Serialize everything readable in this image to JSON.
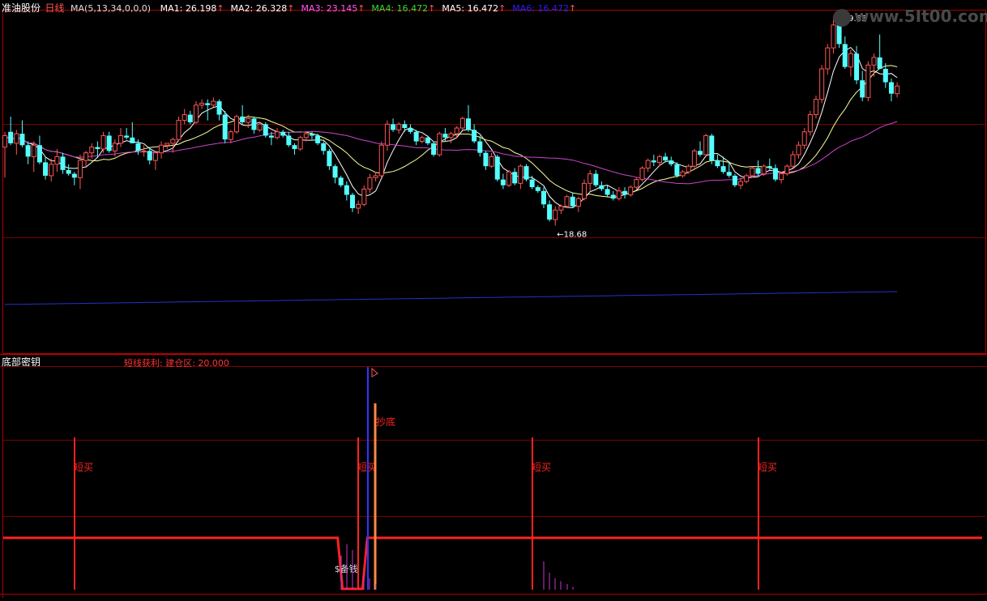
{
  "header": {
    "stock_name": "准油股份",
    "period": "日线",
    "ma_params": "MA(5,13,34,0,0,0)",
    "ma_items": [
      {
        "label": "MA1:",
        "value": "26.198",
        "arrow": "↑",
        "color": "#ffffff"
      },
      {
        "label": "MA2:",
        "value": "26.328",
        "arrow": "↑",
        "color": "#ffffff"
      },
      {
        "label": "MA3:",
        "value": "23.145",
        "arrow": "↑",
        "color": "#ff55ff"
      },
      {
        "label": "MA4:",
        "value": "16.472",
        "arrow": "↑",
        "color": "#33dd33"
      },
      {
        "label": "MA5:",
        "value": "16.472",
        "arrow": "↑",
        "color": "#ffffff"
      },
      {
        "label": "MA6:",
        "value": "16.472",
        "arrow": "↑",
        "color": "#2222ff"
      }
    ]
  },
  "watermark": "www.5It00.com",
  "colors": {
    "background": "#000000",
    "up_candle": "#ff5555",
    "down_candle": "#54ffff",
    "ma_short": "#ffffff",
    "ma_mid": "#ffff99",
    "ma_long": "#cc44cc",
    "ma_very_long": "#2233cc",
    "grid": "#7a0000",
    "signal_red": "#ff2222",
    "signal_blue": "#3333ff",
    "signal_orange": "#ff8844",
    "histogram": "#cc33cc"
  },
  "chart_data": [
    {
      "type": "candlestick",
      "panel": "price",
      "annotations": [
        {
          "text": "29.65",
          "kind": "high"
        },
        {
          "text": "18.68",
          "kind": "low"
        }
      ],
      "candles_ohlc": [
        [
          22.8,
          23.6,
          21.2,
          23.4
        ],
        [
          23.6,
          24.4,
          22.9,
          23.0
        ],
        [
          23.0,
          23.7,
          22.4,
          23.5
        ],
        [
          23.5,
          24.2,
          22.8,
          22.9
        ],
        [
          22.9,
          23.1,
          21.9,
          22.3
        ],
        [
          22.3,
          23.1,
          21.5,
          22.9
        ],
        [
          22.9,
          23.4,
          21.9,
          22.0
        ],
        [
          22.0,
          22.3,
          21.1,
          21.3
        ],
        [
          21.3,
          22.2,
          21.0,
          21.9
        ],
        [
          21.9,
          22.7,
          21.5,
          22.3
        ],
        [
          22.3,
          22.5,
          21.4,
          21.6
        ],
        [
          21.6,
          21.9,
          21.3,
          21.4
        ],
        [
          21.4,
          21.5,
          20.8,
          21.2
        ],
        [
          21.2,
          22.4,
          20.6,
          22.1
        ],
        [
          22.1,
          22.6,
          21.8,
          22.5
        ],
        [
          22.5,
          23.0,
          22.2,
          22.8
        ],
        [
          22.8,
          23.1,
          22.3,
          22.7
        ],
        [
          22.7,
          23.6,
          22.5,
          23.4
        ],
        [
          23.4,
          23.6,
          22.5,
          22.6
        ],
        [
          22.6,
          23.2,
          22.3,
          23.0
        ],
        [
          23.0,
          23.8,
          22.8,
          23.4
        ],
        [
          23.4,
          23.8,
          23.2,
          23.3
        ],
        [
          23.3,
          24.1,
          23.2,
          23.0
        ],
        [
          23.0,
          23.2,
          22.4,
          22.6
        ],
        [
          22.6,
          22.9,
          22.3,
          22.6
        ],
        [
          22.6,
          22.8,
          21.9,
          22.1
        ],
        [
          22.1,
          22.6,
          21.6,
          22.5
        ],
        [
          22.5,
          23.1,
          22.2,
          22.9
        ],
        [
          22.9,
          23.0,
          22.7,
          23.0
        ],
        [
          23.0,
          23.3,
          22.5,
          23.2
        ],
        [
          23.2,
          24.4,
          23.1,
          24.2
        ],
        [
          24.2,
          24.8,
          24.0,
          24.5
        ],
        [
          24.5,
          24.7,
          24.0,
          24.1
        ],
        [
          24.1,
          25.2,
          24.0,
          25.0
        ],
        [
          25.0,
          25.3,
          24.8,
          25.1
        ],
        [
          25.1,
          25.3,
          24.2,
          25.0
        ],
        [
          25.0,
          25.4,
          24.9,
          25.2
        ],
        [
          25.2,
          25.3,
          24.2,
          24.5
        ],
        [
          24.5,
          24.7,
          23.0,
          23.2
        ],
        [
          23.2,
          23.7,
          23.0,
          23.6
        ],
        [
          23.6,
          24.5,
          23.5,
          24.4
        ],
        [
          24.4,
          25.0,
          24.0,
          24.1
        ],
        [
          24.1,
          24.5,
          23.8,
          24.3
        ],
        [
          24.3,
          24.4,
          23.5,
          23.7
        ],
        [
          23.7,
          24.1,
          23.6,
          24.0
        ],
        [
          24.0,
          24.1,
          23.3,
          23.4
        ],
        [
          23.4,
          23.6,
          22.9,
          23.3
        ],
        [
          23.3,
          23.8,
          23.2,
          23.6
        ],
        [
          23.6,
          23.7,
          23.3,
          23.4
        ],
        [
          23.4,
          23.6,
          22.8,
          22.9
        ],
        [
          22.9,
          23.0,
          22.4,
          22.7
        ],
        [
          22.7,
          23.4,
          22.6,
          23.3
        ],
        [
          23.3,
          23.6,
          23.1,
          23.5
        ],
        [
          23.5,
          23.6,
          23.2,
          23.4
        ],
        [
          23.4,
          23.5,
          22.9,
          23.0
        ],
        [
          23.0,
          23.1,
          22.4,
          22.6
        ],
        [
          22.6,
          22.7,
          21.6,
          21.8
        ],
        [
          21.8,
          21.9,
          20.9,
          21.2
        ],
        [
          21.2,
          21.3,
          20.7,
          20.8
        ],
        [
          20.8,
          21.0,
          20.0,
          20.3
        ],
        [
          20.3,
          20.4,
          19.4,
          19.6
        ],
        [
          19.6,
          20.0,
          19.3,
          19.8
        ],
        [
          19.8,
          20.8,
          19.7,
          20.6
        ],
        [
          20.6,
          21.4,
          20.4,
          21.2
        ],
        [
          21.2,
          21.5,
          21.0,
          21.3
        ],
        [
          21.3,
          23.1,
          21.2,
          22.9
        ],
        [
          22.9,
          24.2,
          22.6,
          24.0
        ],
        [
          24.0,
          24.3,
          23.6,
          23.7
        ],
        [
          23.7,
          24.1,
          23.5,
          24.0
        ],
        [
          24.0,
          24.2,
          23.6,
          23.8
        ],
        [
          23.8,
          24.0,
          23.5,
          23.6
        ],
        [
          23.6,
          23.7,
          22.9,
          23.1
        ],
        [
          23.1,
          23.4,
          23.0,
          23.3
        ],
        [
          23.3,
          23.4,
          22.9,
          23.0
        ],
        [
          23.0,
          23.1,
          22.3,
          22.4
        ],
        [
          22.4,
          23.6,
          22.3,
          23.5
        ],
        [
          23.5,
          23.8,
          23.1,
          23.3
        ],
        [
          23.3,
          23.6,
          23.0,
          23.5
        ],
        [
          23.5,
          23.9,
          23.3,
          23.8
        ],
        [
          23.8,
          24.4,
          23.7,
          24.3
        ],
        [
          24.3,
          25.0,
          23.6,
          23.7
        ],
        [
          23.7,
          24.0,
          23.0,
          23.1
        ],
        [
          23.1,
          23.4,
          22.3,
          22.5
        ],
        [
          22.5,
          22.6,
          21.6,
          21.8
        ],
        [
          21.8,
          22.5,
          21.7,
          22.3
        ],
        [
          22.3,
          22.4,
          21.0,
          21.1
        ],
        [
          21.1,
          21.4,
          20.6,
          20.8
        ],
        [
          20.8,
          21.6,
          20.7,
          21.5
        ],
        [
          21.5,
          21.7,
          20.8,
          20.9
        ],
        [
          20.9,
          21.9,
          20.6,
          21.8
        ],
        [
          21.8,
          21.9,
          21.0,
          21.1
        ],
        [
          21.1,
          21.3,
          20.6,
          20.7
        ],
        [
          20.7,
          20.8,
          20.4,
          20.5
        ],
        [
          20.5,
          20.7,
          19.6,
          19.8
        ],
        [
          19.8,
          20.0,
          18.9,
          19.0
        ],
        [
          19.0,
          19.7,
          18.68,
          19.5
        ],
        [
          19.5,
          19.8,
          19.3,
          19.7
        ],
        [
          19.7,
          20.3,
          19.6,
          20.2
        ],
        [
          20.2,
          20.4,
          19.6,
          19.7
        ],
        [
          19.7,
          20.2,
          19.4,
          20.1
        ],
        [
          20.1,
          21.1,
          20.0,
          20.9
        ],
        [
          20.9,
          21.6,
          20.5,
          21.4
        ],
        [
          21.4,
          21.6,
          20.7,
          20.8
        ],
        [
          20.8,
          21.0,
          20.5,
          20.6
        ],
        [
          20.6,
          20.8,
          20.2,
          20.3
        ],
        [
          20.3,
          20.5,
          20.0,
          20.1
        ],
        [
          20.1,
          20.7,
          20.0,
          20.5
        ],
        [
          20.5,
          20.7,
          20.1,
          20.3
        ],
        [
          20.3,
          20.8,
          20.2,
          20.7
        ],
        [
          20.7,
          21.2,
          20.6,
          21.1
        ],
        [
          21.1,
          21.8,
          21.0,
          21.7
        ],
        [
          21.7,
          22.2,
          21.5,
          22.1
        ],
        [
          22.1,
          22.4,
          21.8,
          22.0
        ],
        [
          22.0,
          22.4,
          21.8,
          22.3
        ],
        [
          22.3,
          22.5,
          22.0,
          22.1
        ],
        [
          22.1,
          22.3,
          21.8,
          21.9
        ],
        [
          21.9,
          22.0,
          21.2,
          21.3
        ],
        [
          21.3,
          21.6,
          21.2,
          21.5
        ],
        [
          21.5,
          21.9,
          21.4,
          21.8
        ],
        [
          21.8,
          22.7,
          21.7,
          22.6
        ],
        [
          22.6,
          23.1,
          22.3,
          22.4
        ],
        [
          22.4,
          23.5,
          22.3,
          23.4
        ],
        [
          23.4,
          23.5,
          21.9,
          22.1
        ],
        [
          22.1,
          22.4,
          21.7,
          21.8
        ],
        [
          21.8,
          22.3,
          21.4,
          21.5
        ],
        [
          21.5,
          22.0,
          21.2,
          21.3
        ],
        [
          21.3,
          21.4,
          20.7,
          20.8
        ],
        [
          20.8,
          21.2,
          20.6,
          21.0
        ],
        [
          21.0,
          21.4,
          20.9,
          21.3
        ],
        [
          21.3,
          21.8,
          21.2,
          21.7
        ],
        [
          21.7,
          22.1,
          21.3,
          21.4
        ],
        [
          21.4,
          21.9,
          21.3,
          21.8
        ],
        [
          21.8,
          22.2,
          21.6,
          21.7
        ],
        [
          21.7,
          21.9,
          21.0,
          21.1
        ],
        [
          21.1,
          21.5,
          20.9,
          21.4
        ],
        [
          21.4,
          21.9,
          21.3,
          21.8
        ],
        [
          21.8,
          22.6,
          21.7,
          22.4
        ],
        [
          22.4,
          23.1,
          22.2,
          22.9
        ],
        [
          22.9,
          23.8,
          22.7,
          23.6
        ],
        [
          23.6,
          24.7,
          23.4,
          24.5
        ],
        [
          24.5,
          25.5,
          24.3,
          25.3
        ],
        [
          25.3,
          27.1,
          25.1,
          26.9
        ],
        [
          26.9,
          28.2,
          26.6,
          28.0
        ],
        [
          28.0,
          29.65,
          27.7,
          29.2
        ],
        [
          29.2,
          29.3,
          28.0,
          28.2
        ],
        [
          28.2,
          28.6,
          26.9,
          27.0
        ],
        [
          27.0,
          27.9,
          26.5,
          27.7
        ],
        [
          27.7,
          28.1,
          26.1,
          26.3
        ],
        [
          26.3,
          26.8,
          25.2,
          25.4
        ],
        [
          25.4,
          27.3,
          25.2,
          27.1
        ],
        [
          27.1,
          27.7,
          26.5,
          27.5
        ],
        [
          27.5,
          28.7,
          27.2,
          26.9
        ],
        [
          26.9,
          27.2,
          25.9,
          26.2
        ],
        [
          26.2,
          26.4,
          25.2,
          25.6
        ],
        [
          25.6,
          26.2,
          25.4,
          26.0
        ]
      ]
    },
    {
      "type": "signal_indicator",
      "panel": "indicator",
      "title": "底部密钥",
      "subtitle": "短线获利: 建仓区: 20.000",
      "baseline_value": 20,
      "labels": {
        "short_buy": "短买",
        "bottom": "抄底",
        "prepare": "备钱"
      },
      "short_buy_bars": [
        12,
        61,
        91,
        130
      ],
      "histogram": [
        {
          "bar": 58,
          "height": 12
        },
        {
          "bar": 59,
          "height": 16
        },
        {
          "bar": 60,
          "height": 14
        },
        {
          "bar": 62,
          "height": 6
        },
        {
          "bar": 63,
          "height": 4
        },
        {
          "bar": 64,
          "height": 2
        },
        {
          "bar": 93,
          "height": 10
        },
        {
          "bar": 94,
          "height": 6
        },
        {
          "bar": 95,
          "height": 4
        },
        {
          "bar": 96,
          "height": 3
        },
        {
          "bar": 97,
          "height": 2
        },
        {
          "bar": 98,
          "height": 1
        }
      ]
    }
  ]
}
